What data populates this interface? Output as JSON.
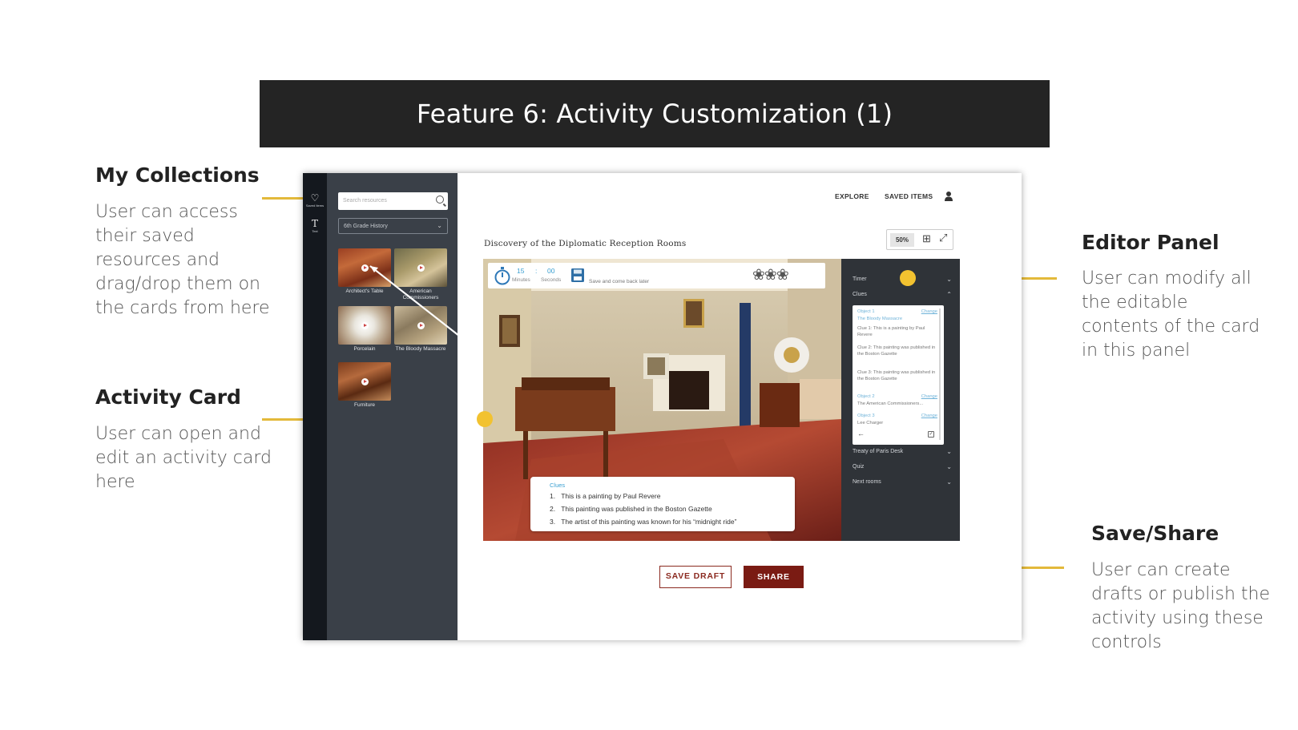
{
  "banner": {
    "title": "Feature 6: Activity Customization (1)"
  },
  "annotations": {
    "collections": {
      "title": "My Collections",
      "lines": [
        "User can access",
        "their saved",
        "resources and",
        "drag/drop them on",
        "the cards from here"
      ]
    },
    "activity_card": {
      "title": "Activity Card",
      "lines": [
        "User can open and",
        "edit an activity card",
        "here"
      ]
    },
    "editor_panel": {
      "title": "Editor Panel",
      "lines": [
        "User can modify all",
        "the editable",
        "contents of the card",
        "in this panel"
      ]
    },
    "save_share": {
      "title": "Save/Share",
      "lines": [
        "User can create",
        "drafts or publish the",
        "activity using these",
        "controls"
      ]
    }
  },
  "rail": {
    "saved_label": "Saved Items",
    "text_label": "Text",
    "saved_icon": "heart-icon",
    "text_icon": "text-icon"
  },
  "sidebar": {
    "search_placeholder": "Search resources",
    "grade_select": "6th Grade History",
    "items": [
      {
        "label": "Architect's Table"
      },
      {
        "label": "American Commissioners"
      },
      {
        "label": "Porcelain"
      },
      {
        "label": "The Bloody Massacre"
      },
      {
        "label": "Furniture"
      }
    ]
  },
  "topnav": {
    "explore": "EXPLORE",
    "saved_items": "SAVED ITEMS",
    "user_icon": "user-icon"
  },
  "card": {
    "title": "Discovery of the Diplomatic Reception Rooms",
    "zoom": "50%",
    "timer": {
      "minutes": "15",
      "seconds": "00",
      "sep": ":",
      "minutes_label": "Minutes",
      "seconds_label": "Seconds"
    },
    "save_later": "Save and come back later",
    "clues": {
      "title": "Clues",
      "items": [
        "This is a painting by Paul Revere",
        "This painting was published in the Boston Gazette",
        "The artist of this painting was known for his “midnight ride”"
      ]
    }
  },
  "editor": {
    "timer_label": "Timer",
    "clues_label": "Clues",
    "box": {
      "object1": "Object 1",
      "change": "Change",
      "object1_name": "The Bloody Massacre",
      "clue1": "Clue 1: This is a painting by Paul Revere",
      "clue2": "Clue 2: This painting was published in the Boston Gazette",
      "clue3": "Clue 3: This painting was published in the Boston Gazette",
      "object2": "Object 2",
      "object2_name": "The American Commissioners...",
      "object3": "Object 3",
      "object3_name": "Lee Charger"
    },
    "sections": [
      "Treaty of Paris Desk",
      "Quiz",
      "Next rooms"
    ]
  },
  "actions": {
    "save_draft": "SAVE DRAFT",
    "share": "SHARE"
  },
  "colors": {
    "accent_yellow": "#f2c230",
    "brand_red": "#7a1b13",
    "link_blue": "#3a9fd1",
    "panel_dark": "#2f3338"
  }
}
